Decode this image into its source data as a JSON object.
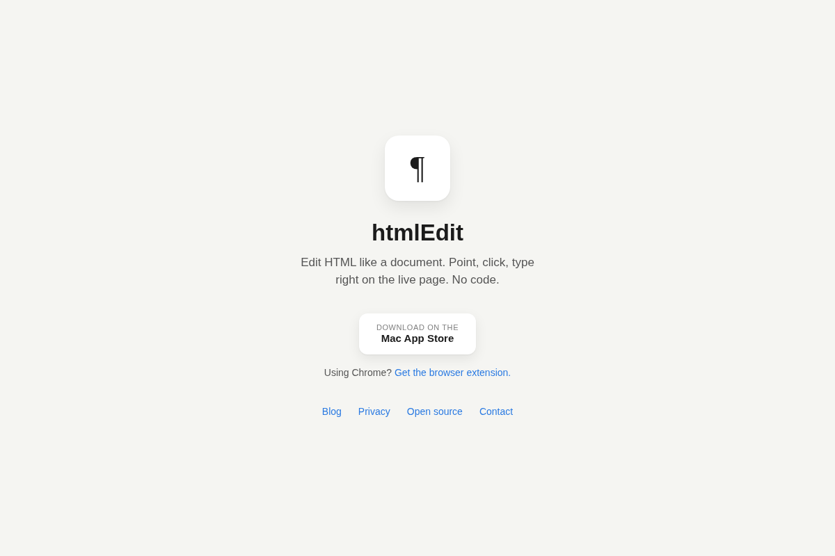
{
  "logo": {
    "glyph": "¶"
  },
  "title": "htmlEdit",
  "tagline": "Edit HTML like a document. Point, click, type right on the live page. No code.",
  "download_button": {
    "eyebrow": "DOWNLOAD ON THE",
    "label": "Mac App Store"
  },
  "chrome_note": {
    "text": "Using Chrome?",
    "link": "Get the browser extension."
  },
  "footer_links": [
    "Blog",
    "Privacy",
    "Open source",
    "Contact"
  ]
}
